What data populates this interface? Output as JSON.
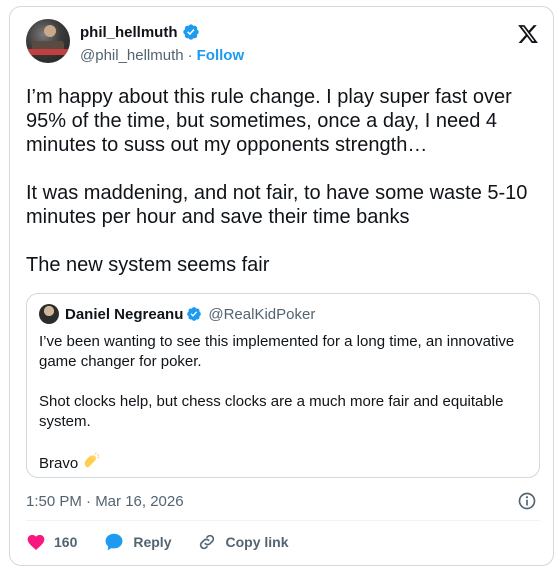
{
  "author": {
    "display_name": "phil_hellmuth",
    "handle": "@phil_hellmuth",
    "follow_label": "Follow",
    "separator": "·"
  },
  "tweet": {
    "text": "I’m happy about this rule change. I play super fast over 95% of the time, but sometimes, once a day, I need 4 minutes to suss out my opponents strength…\n\nIt was maddening, and not fair, to have some waste 5-10 minutes per hour and save their time banks\n\nThe new system seems fair",
    "timestamp": "1:50 PM · Mar 16, 2026"
  },
  "quote": {
    "display_name": "Daniel Negreanu",
    "handle": "@RealKidPoker",
    "text": "I’ve been wanting to see this implemented for a long time, an innovative game changer for poker.\n\nShot clocks help, but chess clocks are a much more fair and equitable system.\n\nBravo"
  },
  "actions": {
    "like_count": "160",
    "reply_label": "Reply",
    "copy_link_label": "Copy link"
  },
  "colors": {
    "accent": "#1d9bf0",
    "like": "#f91880",
    "text": "#0f1419",
    "muted": "#536471",
    "border": "#cfd9de"
  },
  "icons": [
    "verified-badge-icon",
    "x-logo-icon",
    "info-icon",
    "heart-icon",
    "reply-bubble-icon",
    "link-icon",
    "clapping-hands-icon"
  ]
}
